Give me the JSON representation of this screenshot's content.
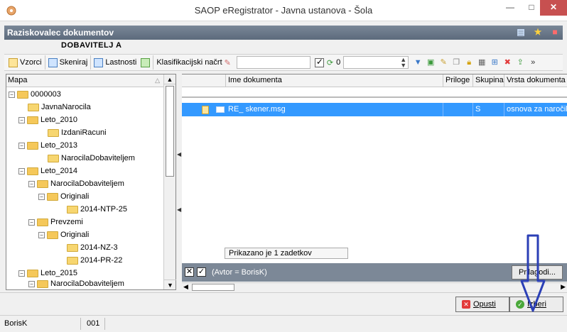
{
  "window": {
    "title": "SAOP eRegistrator - Javna ustanova - Šola"
  },
  "panel": {
    "title": "Raziskovalec dokumentov",
    "owner": "DOBAVITELJ A"
  },
  "toolbar": {
    "templates": "Vzorci",
    "scan": "Skeniraj",
    "properties": "Lastnosti",
    "classification": "Klasifikacijski načrt",
    "counter": "0"
  },
  "tree": {
    "header": "Mapa",
    "items": [
      {
        "label": "0000003"
      },
      {
        "label": "JavnaNarocila"
      },
      {
        "label": "Leto_2010"
      },
      {
        "label": "IzdaniRacuni"
      },
      {
        "label": "Leto_2013"
      },
      {
        "label": "NarocilaDobaviteljem"
      },
      {
        "label": "Leto_2014"
      },
      {
        "label": "NarocilaDobaviteljem"
      },
      {
        "label": "Originali"
      },
      {
        "label": "2014-NTP-25"
      },
      {
        "label": "Prevzemi"
      },
      {
        "label": "Originali"
      },
      {
        "label": "2014-NZ-3"
      },
      {
        "label": "2014-PR-22"
      },
      {
        "label": "Leto_2015"
      },
      {
        "label": "NarocilaDobaviteljem"
      }
    ]
  },
  "grid": {
    "columns": [
      "Ime dokumenta",
      "Priloge",
      "Skupina",
      "Vrsta dokumenta"
    ],
    "rows": [
      {
        "name": "RE_ skener.msg",
        "attachments": "",
        "group": "S",
        "type": "osnova za naročilo"
      }
    ],
    "status": "Prikazano je 1 zadetkov",
    "filter": "(Avtor = BorisK)",
    "customize": "Prilagodi..."
  },
  "buttons": {
    "cancel": "Opusti",
    "select": "Izberi"
  },
  "statusbar": {
    "user": "BorisK",
    "code": "001"
  },
  "colors": {
    "selection": "#3399ff",
    "header": "#6b788a",
    "arrow": "#2b3fb6"
  }
}
